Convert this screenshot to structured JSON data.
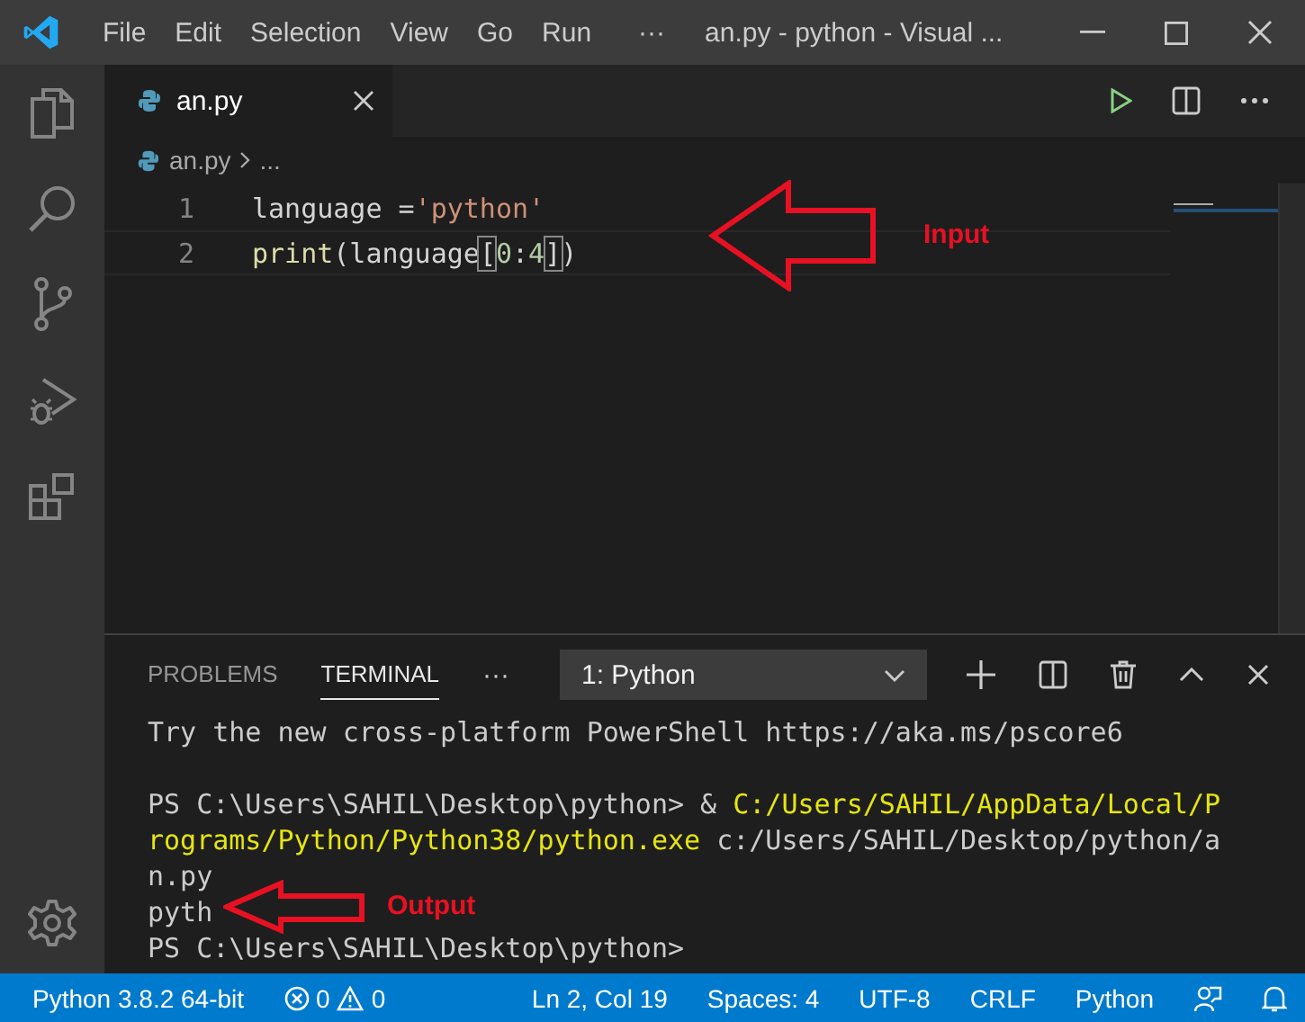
{
  "title_bar": {
    "menus": [
      "File",
      "Edit",
      "Selection",
      "View",
      "Go",
      "Run"
    ],
    "more": "···",
    "title": "an.py - python - Visual ..."
  },
  "activity_bar": {
    "items": [
      {
        "kind": "files",
        "selected": false
      },
      {
        "kind": "search",
        "selected": false
      },
      {
        "kind": "source-control",
        "selected": false
      },
      {
        "kind": "run",
        "selected": false
      },
      {
        "kind": "extensions",
        "selected": false
      }
    ]
  },
  "tabs": [
    {
      "label": "an.py",
      "selected": true
    }
  ],
  "breadcrumb": [
    "an.py",
    "..."
  ],
  "code_lines": [
    {
      "number": "1",
      "tokens": [
        {
          "kind": "plain",
          "text": "language ="
        },
        {
          "kind": "string",
          "text": "'python'"
        }
      ]
    },
    {
      "number": "2",
      "tokens": [
        {
          "kind": "function",
          "text": "print"
        },
        {
          "kind": "plain",
          "text": "(language"
        },
        {
          "kind": "bracket",
          "text": "["
        },
        {
          "kind": "number",
          "text": "0"
        },
        {
          "kind": "plain",
          "text": ":"
        },
        {
          "kind": "number",
          "text": "4"
        },
        {
          "kind": "bracket",
          "text": "]"
        },
        {
          "kind": "plain",
          "text": ")"
        }
      ]
    }
  ],
  "annotations": [
    {
      "kind": "input",
      "label": "Input"
    },
    {
      "kind": "output",
      "label": "Output"
    }
  ],
  "panel": {
    "tabs": [
      {
        "label": "PROBLEMS",
        "selected": false
      },
      {
        "label": "TERMINAL",
        "selected": true
      }
    ],
    "more": "···",
    "terminal_select": "1: Python",
    "terminal_blocks": [
      [
        [
          {
            "kind": "plain",
            "text": "Try the new cross-platform PowerShell https://aka.ms/pscore6"
          }
        ]
      ],
      [
        [
          {
            "kind": "plain",
            "text": "PS C:\\Users\\SAHIL\\Desktop\\python> & "
          },
          {
            "kind": "path",
            "text": "C:/Users/SAHIL/AppData/Local/Programs/Python/Python38/python.exe"
          },
          {
            "kind": "plain",
            "text": " c:/Users/SAHIL/Desktop/python/an.py"
          }
        ],
        [
          {
            "kind": "plain",
            "text": "pyth"
          }
        ],
        [
          {
            "kind": "plain",
            "text": "PS C:\\Users\\SAHIL\\Desktop\\python>"
          }
        ]
      ]
    ]
  },
  "status_bar": {
    "interpreter": "Python 3.8.2 64-bit",
    "errors": "0",
    "warnings": "0",
    "position": "Ln 2, Col 19",
    "spaces": "Spaces: 4",
    "encoding": "UTF-8",
    "eol": "CRLF",
    "language": "Python"
  }
}
